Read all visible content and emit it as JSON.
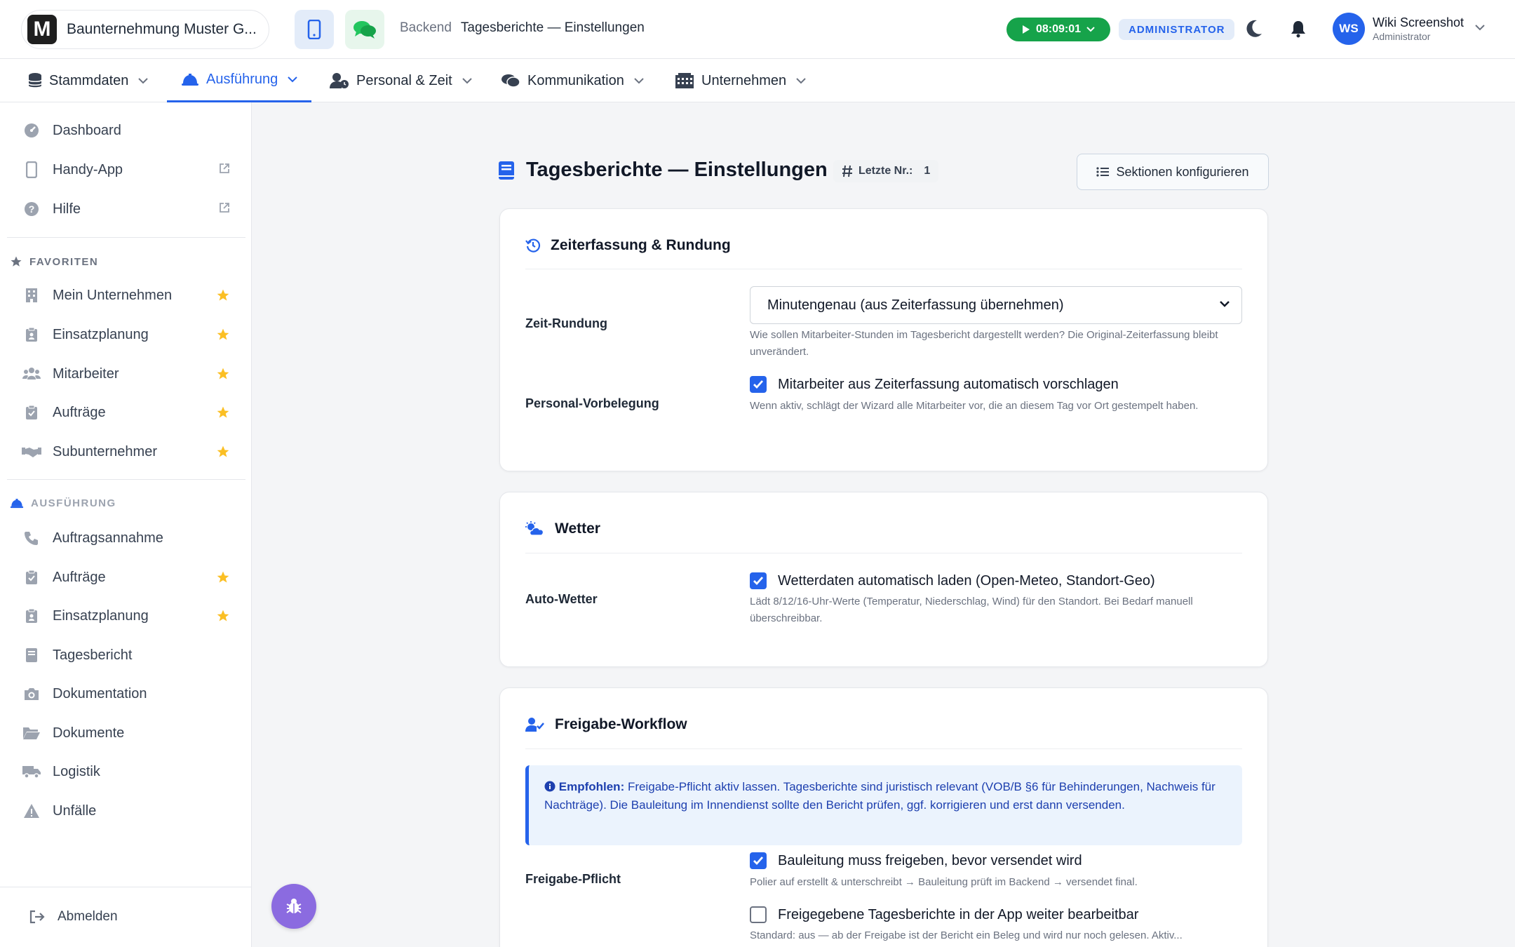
{
  "header": {
    "company_name": "Baunternehmung Muster G...",
    "logo_letter": "M",
    "breadcrumb_root": "Backend",
    "breadcrumb_page": "Tagesberichte — Einstellungen",
    "timer": "08:09:01",
    "role_badge": "ADMINISTRATOR",
    "user_initials": "WS",
    "user_name": "Wiki Screenshot",
    "user_role": "Administrator"
  },
  "main_nav": [
    {
      "label": "Stammdaten",
      "icon": "database-icon"
    },
    {
      "label": "Ausführung",
      "icon": "helmet-icon",
      "active": true
    },
    {
      "label": "Personal & Zeit",
      "icon": "user-clock-icon"
    },
    {
      "label": "Kommunikation",
      "icon": "comments-icon"
    },
    {
      "label": "Unternehmen",
      "icon": "building-icon"
    }
  ],
  "sidebar": {
    "top_items": [
      {
        "label": "Dashboard",
        "icon": "gauge-icon"
      },
      {
        "label": "Handy-App",
        "icon": "mobile-icon",
        "external": true
      },
      {
        "label": "Hilfe",
        "icon": "question-icon",
        "external": true
      }
    ],
    "favorites_heading": "FAVORITEN",
    "favorites": [
      {
        "label": "Mein Unternehmen",
        "icon": "building-icon",
        "starred": true
      },
      {
        "label": "Einsatzplanung",
        "icon": "clipboard-user-icon",
        "starred": true
      },
      {
        "label": "Mitarbeiter",
        "icon": "users-icon",
        "starred": true
      },
      {
        "label": "Aufträge",
        "icon": "clipboard-check-icon",
        "starred": true
      },
      {
        "label": "Subunternehmer",
        "icon": "handshake-icon",
        "starred": true
      }
    ],
    "section_heading": "AUSFÜHRUNG",
    "section_items": [
      {
        "label": "Auftragsannahme",
        "icon": "phone-icon"
      },
      {
        "label": "Aufträge",
        "icon": "clipboard-check-icon",
        "starred": true
      },
      {
        "label": "Einsatzplanung",
        "icon": "clipboard-user-icon",
        "starred": true
      },
      {
        "label": "Tagesbericht",
        "icon": "book-icon"
      },
      {
        "label": "Dokumentation",
        "icon": "camera-icon"
      },
      {
        "label": "Dokumente",
        "icon": "folder-icon"
      },
      {
        "label": "Logistik",
        "icon": "truck-icon"
      },
      {
        "label": "Unfälle",
        "icon": "warning-icon"
      }
    ],
    "logout_label": "Abmelden"
  },
  "page": {
    "title": "Tagesberichte — Einstellungen",
    "last_nr_label": "Letzte Nr.:",
    "last_nr_value": "1",
    "configure_button": "Sektionen konfigurieren"
  },
  "cards": {
    "time": {
      "title": "Zeiterfassung & Rundung",
      "rounding_label": "Zeit-Rundung",
      "rounding_value": "Minutengenau (aus Zeiterfassung übernehmen)",
      "rounding_help": "Wie sollen Mitarbeiter-Stunden im Tagesbericht dargestellt werden? Die Original-Zeiterfassung bleibt unverändert.",
      "staff_label": "Personal-Vorbelegung",
      "staff_check": "Mitarbeiter aus Zeiterfassung automatisch vorschlagen",
      "staff_checked": true,
      "staff_help": "Wenn aktiv, schlägt der Wizard alle Mitarbeiter vor, die an diesem Tag vor Ort gestempelt haben."
    },
    "weather": {
      "title": "Wetter",
      "auto_label": "Auto-Wetter",
      "auto_check": "Wetterdaten automatisch laden (Open-Meteo, Standort-Geo)",
      "auto_checked": true,
      "auto_help": "Lädt 8/12/16-Uhr-Werte (Temperatur, Niederschlag, Wind) für den Standort. Bei Bedarf manuell überschreibbar."
    },
    "approval": {
      "title": "Freigabe-Workflow",
      "alert_strong": "Empfohlen:",
      "alert_text": "Freigabe-Pflicht aktiv lassen. Tagesberichte sind juristisch relevant (VOB/B §6 für Behinderungen, Nachweis für Nachträge). Die Bauleitung im Innendienst sollte den Bericht prüfen, ggf. korrigieren und erst dann versenden.",
      "required_label": "Freigabe-Pflicht",
      "required_check": "Bauleitung muss freigeben, bevor versendet wird",
      "required_checked": true,
      "required_help": "Polier auf erstellt & unterschreibt → Bauleitung prüft im Backend → versendet final.",
      "editable_check": "Freigegebene Tagesberichte in der App weiter bearbeitbar",
      "editable_checked": false,
      "editable_help": "Standard: aus — ab der Freigabe ist der Bericht ein Beleg und wird nur noch gelesen. Aktiv..."
    }
  },
  "colors": {
    "primary": "#2563eb",
    "timer_green": "#16a34a",
    "star": "#fbbf24",
    "bug_button": "#8b6be0"
  }
}
